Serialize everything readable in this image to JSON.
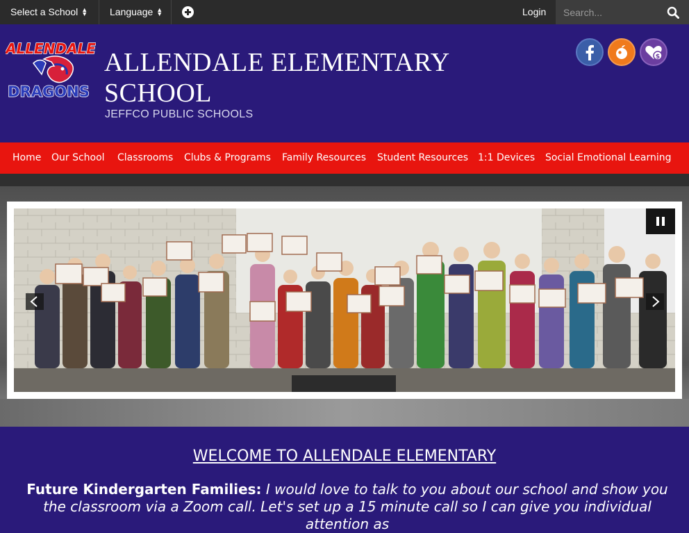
{
  "topbar": {
    "select_school": "Select a School",
    "language": "Language",
    "login": "Login",
    "search_placeholder": "Search..."
  },
  "header": {
    "logo_text_top": "ALLENDALE",
    "logo_text_bottom": "DRAGONS",
    "school_name_line1": "ALLENDALE ELEMENTARY",
    "school_name_line2": "SCHOOL",
    "district": "JEFFCO PUBLIC SCHOOLS",
    "social": [
      {
        "icon": "facebook-icon",
        "color": "#3b5ea8"
      },
      {
        "icon": "peachjar-icon",
        "color": "#f07a1c"
      },
      {
        "icon": "donate-icon",
        "color": "#6b3ea0"
      }
    ]
  },
  "nav": {
    "items": [
      "Home",
      "Our School",
      "Classrooms",
      "Clubs & Programs",
      "Family Resources",
      "Student Resources",
      "1:1 Devices",
      "Social Emotional Learning"
    ]
  },
  "main": {
    "welcome": "WELCOME TO ALLENDALE ELEMENTARY",
    "intro_bold": "Future Kindergarten Families:",
    "intro_text": "I would love to talk to you about our school and show you the classroom via a Zoom call. Let's set up a 15 minute call so I can give you individual attention as"
  },
  "colors": {
    "topbar": "#2b2b2b",
    "brand_purple": "#2a1a7a",
    "nav_red": "#e8150f"
  }
}
